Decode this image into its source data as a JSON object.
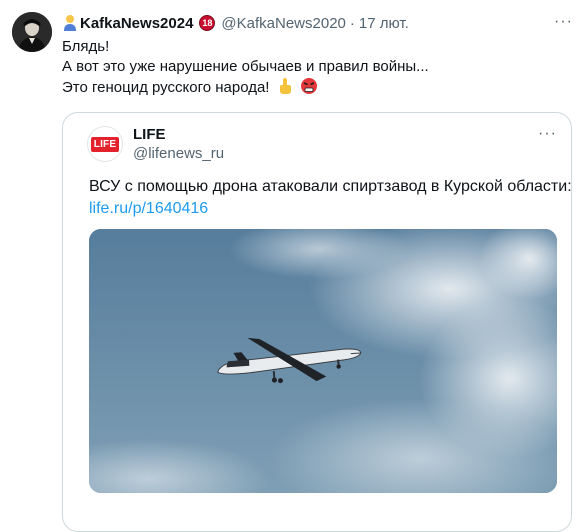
{
  "tweet": {
    "display_name": "KafkaNews2024",
    "age_badge": "18",
    "handle": "@KafkaNews2020",
    "separator": "·",
    "date": "17 лют.",
    "more_label": "···",
    "text_lines": [
      "Блядь!",
      "А вот это уже нарушение обычаев и правил войны...",
      "Это геноцид русского народа!"
    ],
    "emoji_after_text": [
      "pointing-up-icon",
      "angry-face-icon"
    ]
  },
  "quote": {
    "avatar_logo": "LIFE",
    "name": "LIFE",
    "handle": "@lifenews_ru",
    "more_label": "···",
    "text": "ВСУ с помощью дрона атаковали спиртзавод в Курской области:",
    "link": "life.ru/p/1640416",
    "media_icon": "drone-in-sky-photo"
  },
  "colors": {
    "link": "#1d9bf0",
    "secondary_text": "#536471",
    "border": "#cfd9de",
    "life_red": "#e3222c"
  }
}
